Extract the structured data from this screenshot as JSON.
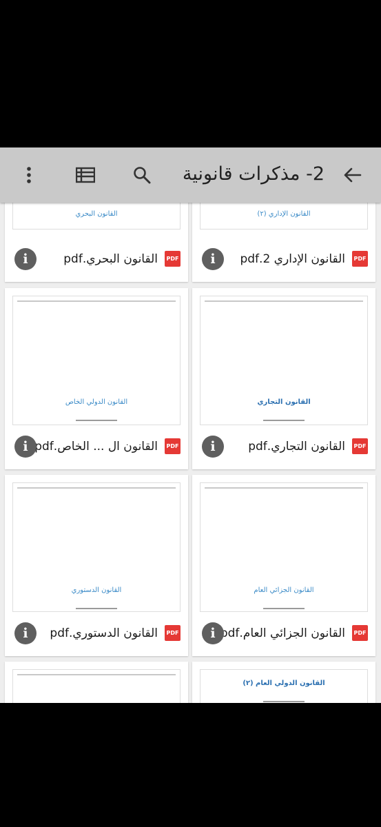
{
  "toolbar": {
    "title": "2- مذكرات قانونية",
    "back_icon": "arrow-left-icon",
    "search_icon": "search-icon",
    "list_icon": "list-view-icon",
    "more_icon": "more-vert-icon"
  },
  "pdf_badge": "PDF",
  "info_glyph": "i",
  "files": [
    {
      "name": "القانون الإداري 2.pdf",
      "thumb_title": "القانون الإداري (٢)"
    },
    {
      "name": "القانون البحري.pdf",
      "thumb_title": "القانون البحري"
    },
    {
      "name": "القانون التجاري.pdf",
      "thumb_title": "القانون التجاري"
    },
    {
      "name": "القانون ال ... الخاص.pdf",
      "thumb_title": "القانون الدولي الخاص"
    },
    {
      "name": "القانون الجزائي العام.pdf",
      "thumb_title": "القانون الجزائي العام"
    },
    {
      "name": "القانون الدستوري.pdf",
      "thumb_title": "القانون الدستوري"
    },
    {
      "name": "",
      "thumb_title": "القانون الدولي العام (٢)"
    },
    {
      "name": "",
      "thumb_title": ""
    }
  ]
}
